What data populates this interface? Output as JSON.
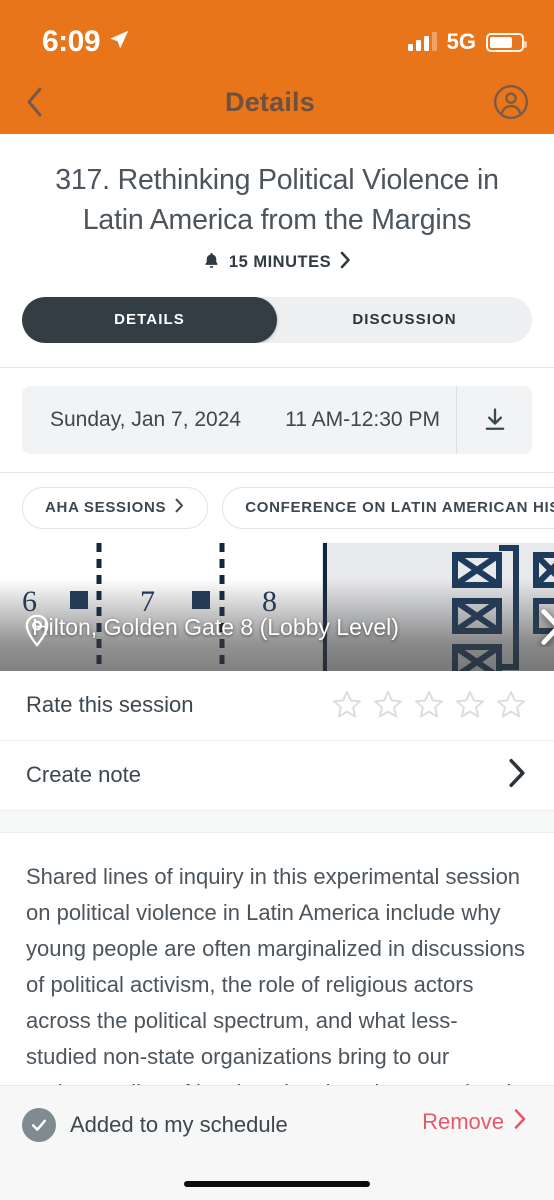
{
  "theme": {
    "accent_orange": "#E8751A",
    "dark_slate": "#333E44",
    "text_gray": "#4C555C",
    "remove_red": "#E6596B",
    "map_navy": "#1E3A5C"
  },
  "status_bar": {
    "time": "6:09",
    "location_icon": "location-arrow-icon",
    "signal_icon": "cellular-signal-icon",
    "network": "5G",
    "battery_icon": "battery-icon"
  },
  "nav": {
    "back_icon": "chevron-left-icon",
    "title": "Details",
    "profile_icon": "account-circle-icon"
  },
  "session": {
    "title": "317. Rethinking Political Violence in Latin America from the Margins",
    "reminder_icon": "bell-icon",
    "reminder_label": "15 MINUTES",
    "reminder_chevron": "chevron-right-icon"
  },
  "tabs": [
    {
      "label": "DETAILS",
      "active": true
    },
    {
      "label": "DISCUSSION",
      "active": false
    }
  ],
  "schedule": {
    "date": "Sunday, Jan 7, 2024",
    "time": "11 AM-12:30 PM",
    "download_icon": "download-icon"
  },
  "chips": [
    {
      "label": "AHA SESSIONS",
      "chevron": "chevron-right-icon"
    },
    {
      "label": "CONFERENCE ON LATIN AMERICAN HISTOR",
      "chevron": ""
    }
  ],
  "map": {
    "pin_icon": "map-pin-icon",
    "location": "Hilton, Golden Gate 8 (Lobby Level)",
    "next_icon": "chevron-right-icon",
    "room_numbers": [
      "6",
      "7",
      "8"
    ]
  },
  "rate": {
    "label": "Rate this session",
    "stars": 5,
    "filled": 0,
    "star_icon": "star-outline-icon"
  },
  "note": {
    "label": "Create note",
    "chevron": "chevron-right-icon"
  },
  "description": "Shared lines of inquiry in this experimental session on political violence in Latin America include why young people are often marginalized in discussions of political activism, the role of religious actors across the political spectrum, and what less-studied non-state organizations bring to our understanding of local, national, and transnational politics.",
  "bottom_bar": {
    "check_icon": "check-circle-icon",
    "status": "Added to my schedule",
    "remove_label": "Remove",
    "remove_chevron": "chevron-right-icon",
    "home_indicator": "home-indicator"
  }
}
